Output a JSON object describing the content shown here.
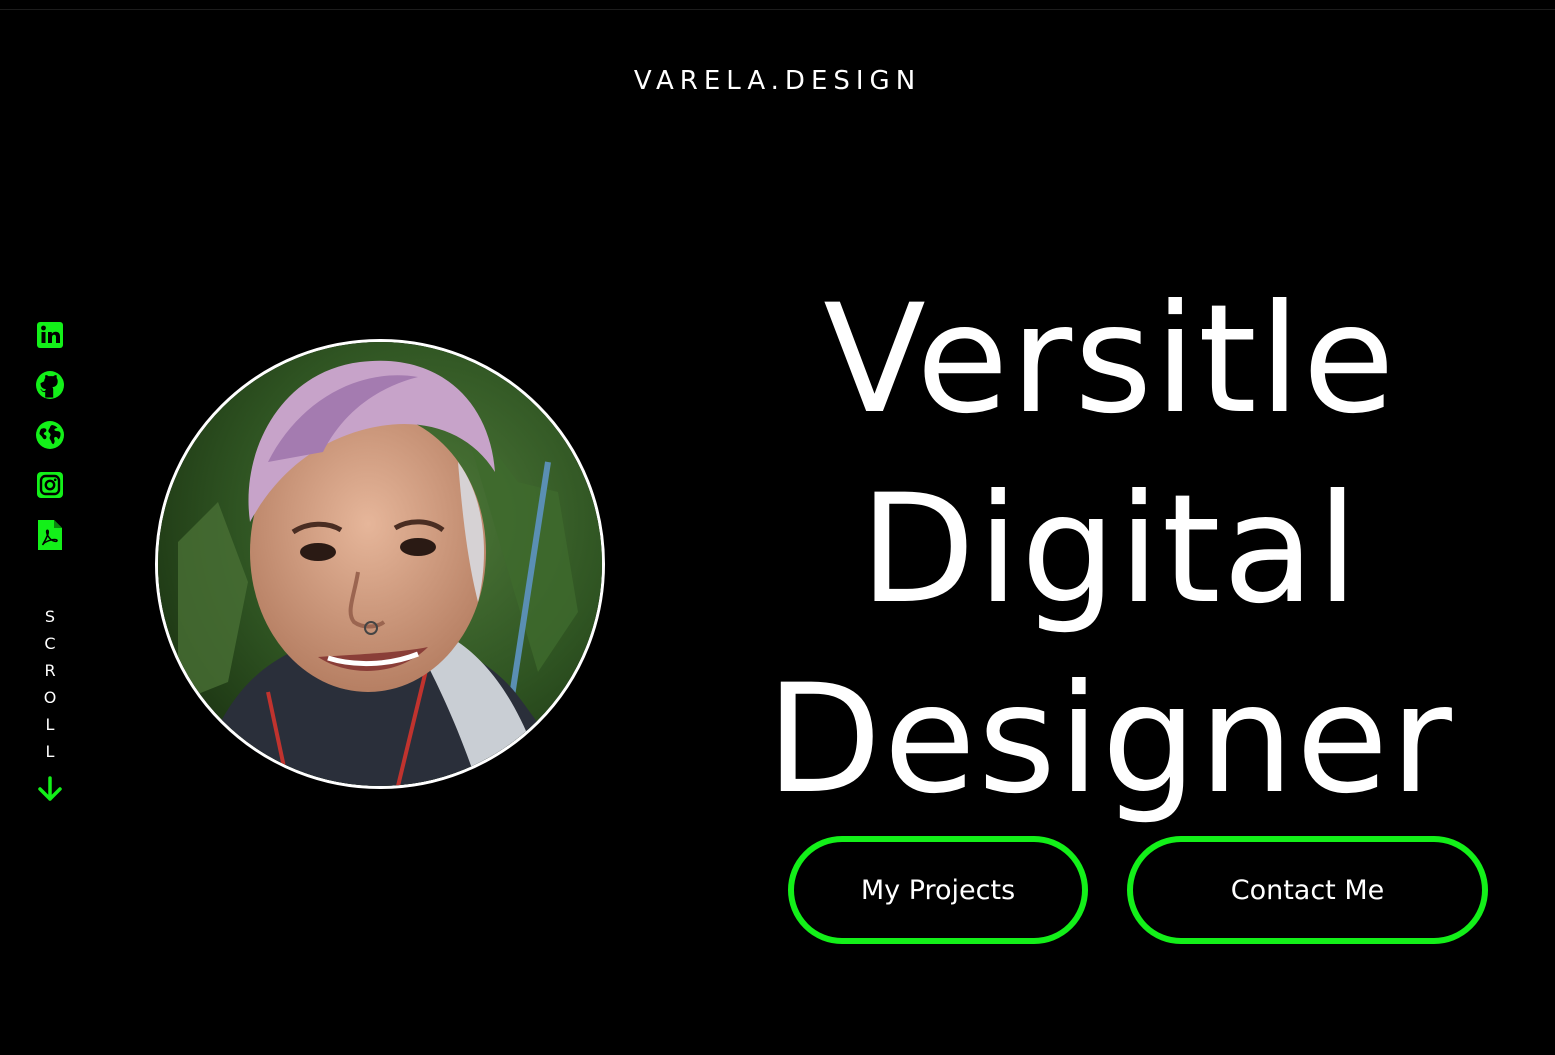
{
  "header": {
    "brand": "VARELA.DESIGN"
  },
  "social": [
    {
      "name": "linkedin-icon"
    },
    {
      "name": "github-icon"
    },
    {
      "name": "globe-icon"
    },
    {
      "name": "instagram-icon"
    },
    {
      "name": "pdf-icon"
    }
  ],
  "scroll": {
    "letters": [
      "S",
      "C",
      "R",
      "O",
      "L",
      "L"
    ]
  },
  "hero": {
    "line1": "Versitle",
    "line2": "Digital",
    "line3": "Designer"
  },
  "buttons": {
    "projects": "My Projects",
    "contact": "Contact Me"
  },
  "colors": {
    "accent": "#13f019",
    "background": "#000000",
    "text": "#ffffff"
  }
}
